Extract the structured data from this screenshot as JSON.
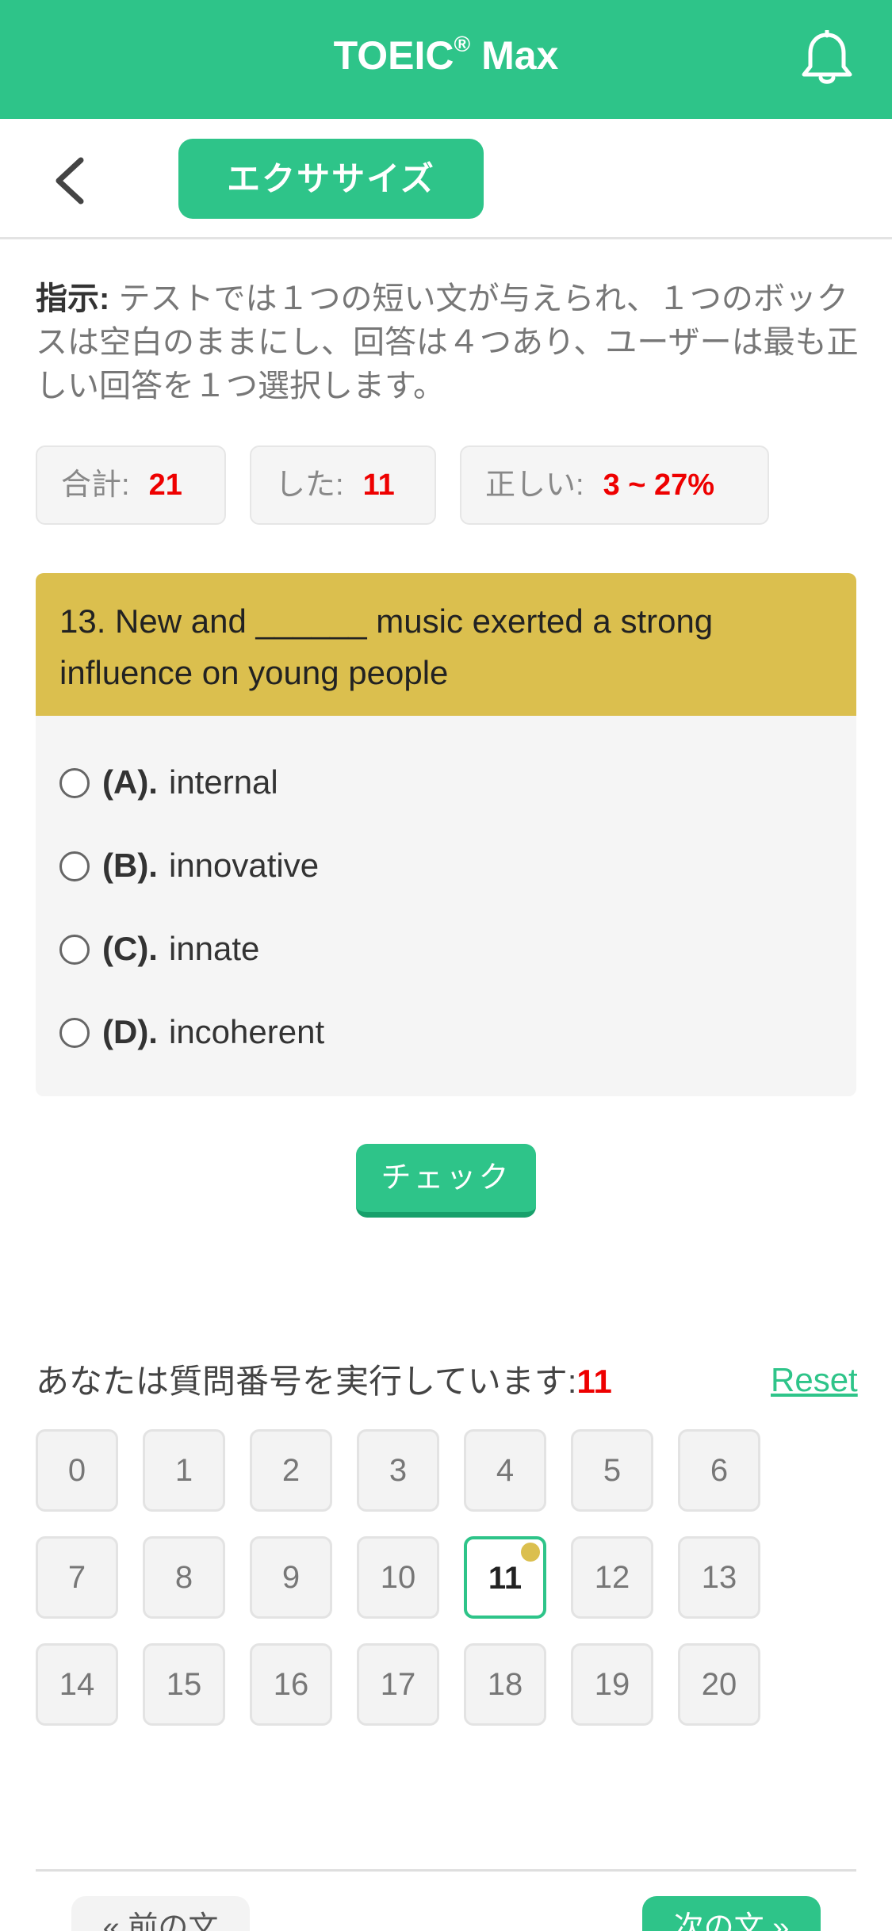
{
  "header": {
    "title": "TOEIC",
    "title_mark": "®",
    "title_suffix": " Max",
    "bell_icon": "bell-icon"
  },
  "toolbar": {
    "back_icon": "chevron-left-icon",
    "tab_label": "エクササイズ"
  },
  "instructions": {
    "label": "指示:",
    "text": " テストでは１つの短い文が与えられ、１つのボックスは空白のままにし、回答は４つあり、ユーザーは最も正しい回答を１つ選択します。"
  },
  "stats": [
    {
      "label": "合計:",
      "value": "21"
    },
    {
      "label": "した:",
      "value": "11"
    },
    {
      "label": "正しい:",
      "value": "3 ~ 27%"
    }
  ],
  "question": {
    "text": "13. New and ______ music exerted a strong influence on young people",
    "options": [
      {
        "letter": "(A).",
        "text": "internal"
      },
      {
        "letter": "(B).",
        "text": "innovative"
      },
      {
        "letter": "(C).",
        "text": "innate"
      },
      {
        "letter": "(D).",
        "text": "incoherent"
      }
    ]
  },
  "check_button": "チェック",
  "progress": {
    "label": "あなたは質問番号を実行しています:",
    "current": "11",
    "reset": "Reset"
  },
  "numbers": [
    "0",
    "1",
    "2",
    "3",
    "4",
    "5",
    "6",
    "7",
    "8",
    "9",
    "10",
    "11",
    "12",
    "13",
    "14",
    "15",
    "16",
    "17",
    "18",
    "19",
    "20"
  ],
  "active_number": "11",
  "nav": {
    "prev": "« 前の文",
    "next": "次の文 »"
  },
  "colors": {
    "accent": "#2ec489",
    "question_header": "#dbbf4e",
    "highlight": "#ee0000"
  }
}
